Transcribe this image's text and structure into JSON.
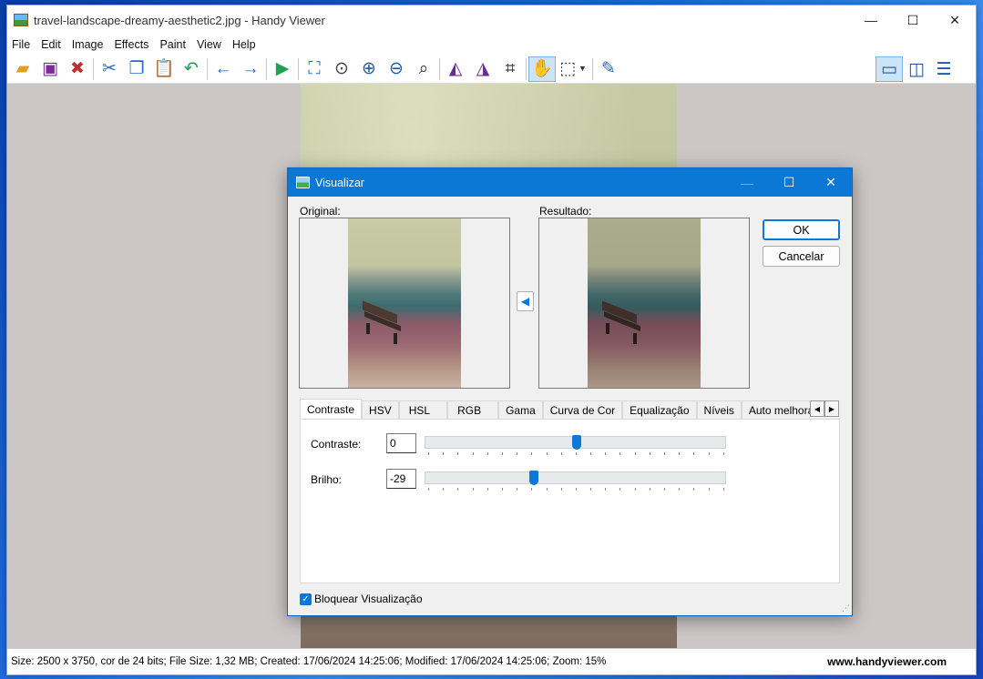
{
  "window": {
    "title": "travel-landscape-dreamy-aesthetic2.jpg - Handy Viewer",
    "minimize": "—",
    "maximize": "☐",
    "close": "✕"
  },
  "menu": [
    "File",
    "Edit",
    "Image",
    "Effects",
    "Paint",
    "View",
    "Help"
  ],
  "toolbar": {
    "icons": [
      "open-folder-icon",
      "save-icon",
      "close-file-icon",
      "cut-icon",
      "copy-icon",
      "paste-icon",
      "undo-icon",
      "back-arrow-icon",
      "forward-arrow-icon",
      "slideshow-icon",
      "fit-window-icon",
      "zoom-region-icon",
      "zoom-in-icon",
      "zoom-out-icon",
      "zoom-reset-icon",
      "flip-icon",
      "rotate-icon",
      "crop-icon",
      "hand-tool-icon",
      "selection-icon",
      "edit-image-icon",
      "single-view-icon",
      "dual-view-icon",
      "tree-view-icon"
    ]
  },
  "dialog": {
    "title": "Visualizar",
    "minimize": "—",
    "maximize": "☐",
    "close": "✕",
    "original_label": "Original:",
    "result_label": "Resultado:",
    "ok": "OK",
    "cancel": "Cancelar",
    "tabs": [
      "Contraste",
      "HSV",
      "HSL",
      "RGB",
      "Gama",
      "Curva de Cor",
      "Equalização",
      "Níveis",
      "Auto melhoramento"
    ],
    "selected_tab": "Contraste",
    "contrast_label": "Contraste:",
    "contrast_value": "0",
    "brightness_label": "Brilho:",
    "brightness_value": "-29",
    "contrast_slider_fraction": 0.5,
    "brightness_slider_fraction": 0.355,
    "lock_preview_label": "Bloquear Visualização",
    "lock_preview_checked": true,
    "accent_color": "#0a78d4"
  },
  "status": {
    "info": "Size: 2500 x 3750, cor de 24 bits; File Size: 1,32 MB; Created: 17/06/2024 14:25:06; Modified: 17/06/2024 14:25:06; Zoom: 15%",
    "website": "www.handyviewer.com"
  }
}
